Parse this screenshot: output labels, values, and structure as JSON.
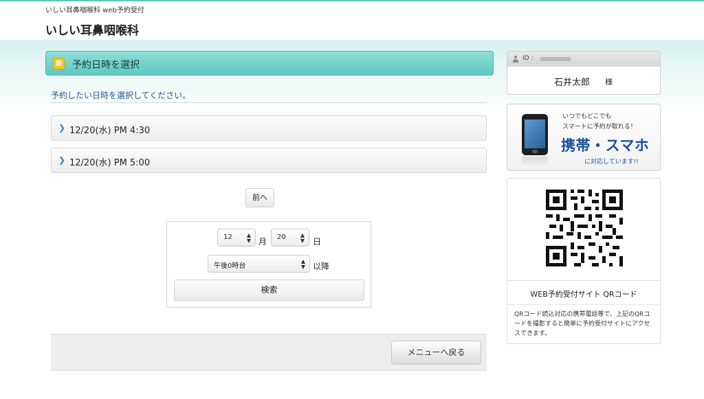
{
  "header": {
    "subtitle": "いしい耳鼻咽喉科 web予約受付",
    "site_title": "いしい耳鼻咽喉科"
  },
  "main": {
    "section_title": "予約日時を選択",
    "instruction": "予約したい日時を選択してください。",
    "slots": [
      {
        "label": "12/20(水) PM 4:30"
      },
      {
        "label": "12/20(水) PM 5:00"
      }
    ],
    "prev_label": "前へ",
    "search": {
      "month_value": "12",
      "month_unit": "月",
      "day_value": "20",
      "day_unit": "日",
      "time_value": "午後0時台",
      "time_unit": "以降",
      "search_label": "検索"
    },
    "back_label": "メニューへ戻る"
  },
  "sidebar": {
    "user": {
      "id_label": "ID :",
      "name": "石井太郎",
      "honorific": "様"
    },
    "promo": {
      "line1": "いつでもどこでも",
      "line2": "スマートに予約が取れる！",
      "headline": "携帯・スマホ",
      "line3": "に対応しています!!"
    },
    "qr": {
      "caption": "WEB予約受付サイト QRコード",
      "description": "QRコード読込対応の携帯電話等で、上記のQRコードを撮影すると簡単に予約受付サイトにアクセスできます。"
    }
  },
  "colors": {
    "accent": "#5fc8c0",
    "link_blue": "#1d5b95",
    "promo_blue": "#1b4f9c"
  }
}
